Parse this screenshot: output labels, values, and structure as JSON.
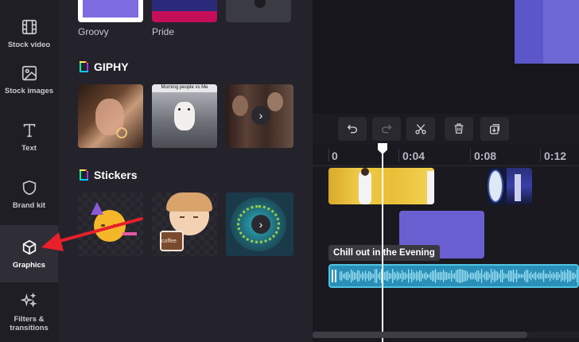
{
  "sidebar": {
    "items": [
      {
        "label": "Stock video",
        "icon": "film-icon"
      },
      {
        "label": "Stock images",
        "icon": "image-icon"
      },
      {
        "label": "Text",
        "icon": "text-icon"
      },
      {
        "label": "Brand kit",
        "icon": "shield-icon"
      },
      {
        "label": "Graphics",
        "icon": "cube-icon",
        "active": true
      },
      {
        "label": "Filters &\ntransitions",
        "icon": "sparkle-icon"
      }
    ]
  },
  "panel": {
    "top_tiles": [
      {
        "label": "Groovy"
      },
      {
        "label": "Pride"
      }
    ],
    "giphy": {
      "title": "GIPHY",
      "caption": "Morning people vs Me"
    },
    "stickers": {
      "title": "Stickers",
      "cup_text": "coffee"
    }
  },
  "timeline": {
    "ticks": [
      "0",
      "0:04",
      "0:08",
      "0:12"
    ],
    "audio_clip_name": "Chill out in the Evening"
  },
  "colors": {
    "accent": "#6a5fd0",
    "audio": "#2a8fb8",
    "annotation_arrow": "#e8202a"
  }
}
